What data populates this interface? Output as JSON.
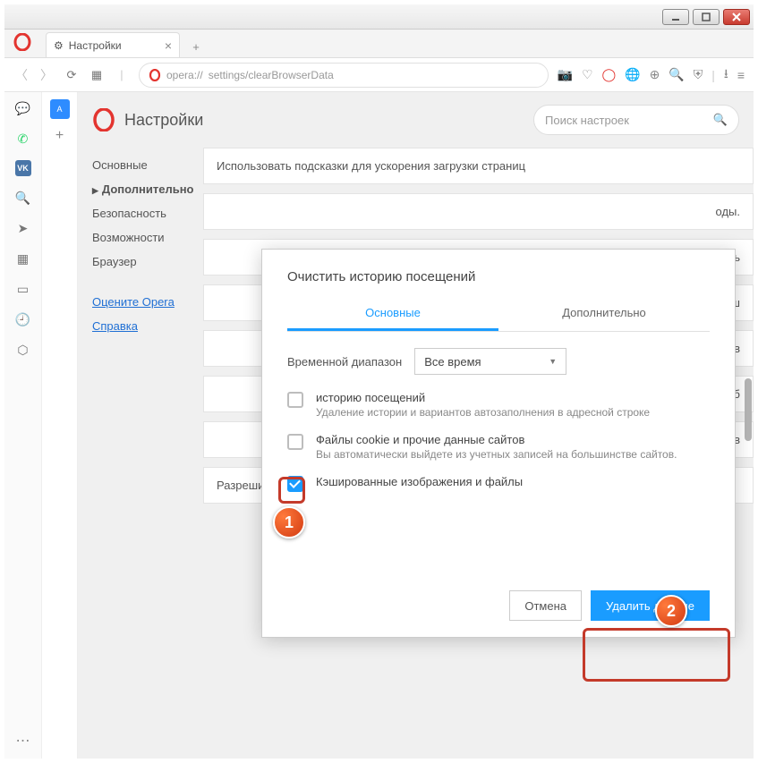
{
  "window": {
    "title": "Opera"
  },
  "tab": {
    "title": "Настройки"
  },
  "addressbar": {
    "url_proto": "opera://",
    "url_path": "settings/clearBrowserData"
  },
  "page": {
    "title": "Настройки",
    "search_placeholder": "Поиск настроек",
    "hint_card": "Использовать подсказки для ускорения загрузки страниц",
    "bottom_card": "Разрешить партнерским поисковым системам проверять, установлены ли они по умолчанию"
  },
  "sidebar": {
    "items": [
      {
        "label": "Основные"
      },
      {
        "label": "Дополнительно"
      },
      {
        "label": "Безопасность"
      },
      {
        "label": "Возможности"
      },
      {
        "label": "Браузер"
      }
    ],
    "links": [
      {
        "label": "Оцените Opera"
      },
      {
        "label": "Справка"
      }
    ]
  },
  "bg_fragments": {
    "f0": "оды.",
    "f1": "нт показывать",
    "f2": "и кеш",
    "f3": "шении в",
    "f4": "ацию об",
    "f5": "в в"
  },
  "dialog": {
    "title": "Очистить историю посещений",
    "tabs": {
      "basic": "Основные",
      "advanced": "Дополнительно"
    },
    "range_label": "Временной диапазон",
    "range_value": "Все время",
    "opts": [
      {
        "label": "историю посещений",
        "sub": "Удаление истории и вариантов автозаполнения в адресной строке",
        "checked": false
      },
      {
        "label": "Файлы cookie и прочие данные сайтов",
        "sub": "Вы автоматически выйдете из учетных записей на большинстве сайтов.",
        "checked": false
      },
      {
        "label": "Кэшированные изображения и файлы",
        "sub": "",
        "checked": true
      }
    ],
    "cancel": "Отмена",
    "confirm": "Удалить данные"
  },
  "annotations": {
    "badge1": "1",
    "badge2": "2"
  }
}
